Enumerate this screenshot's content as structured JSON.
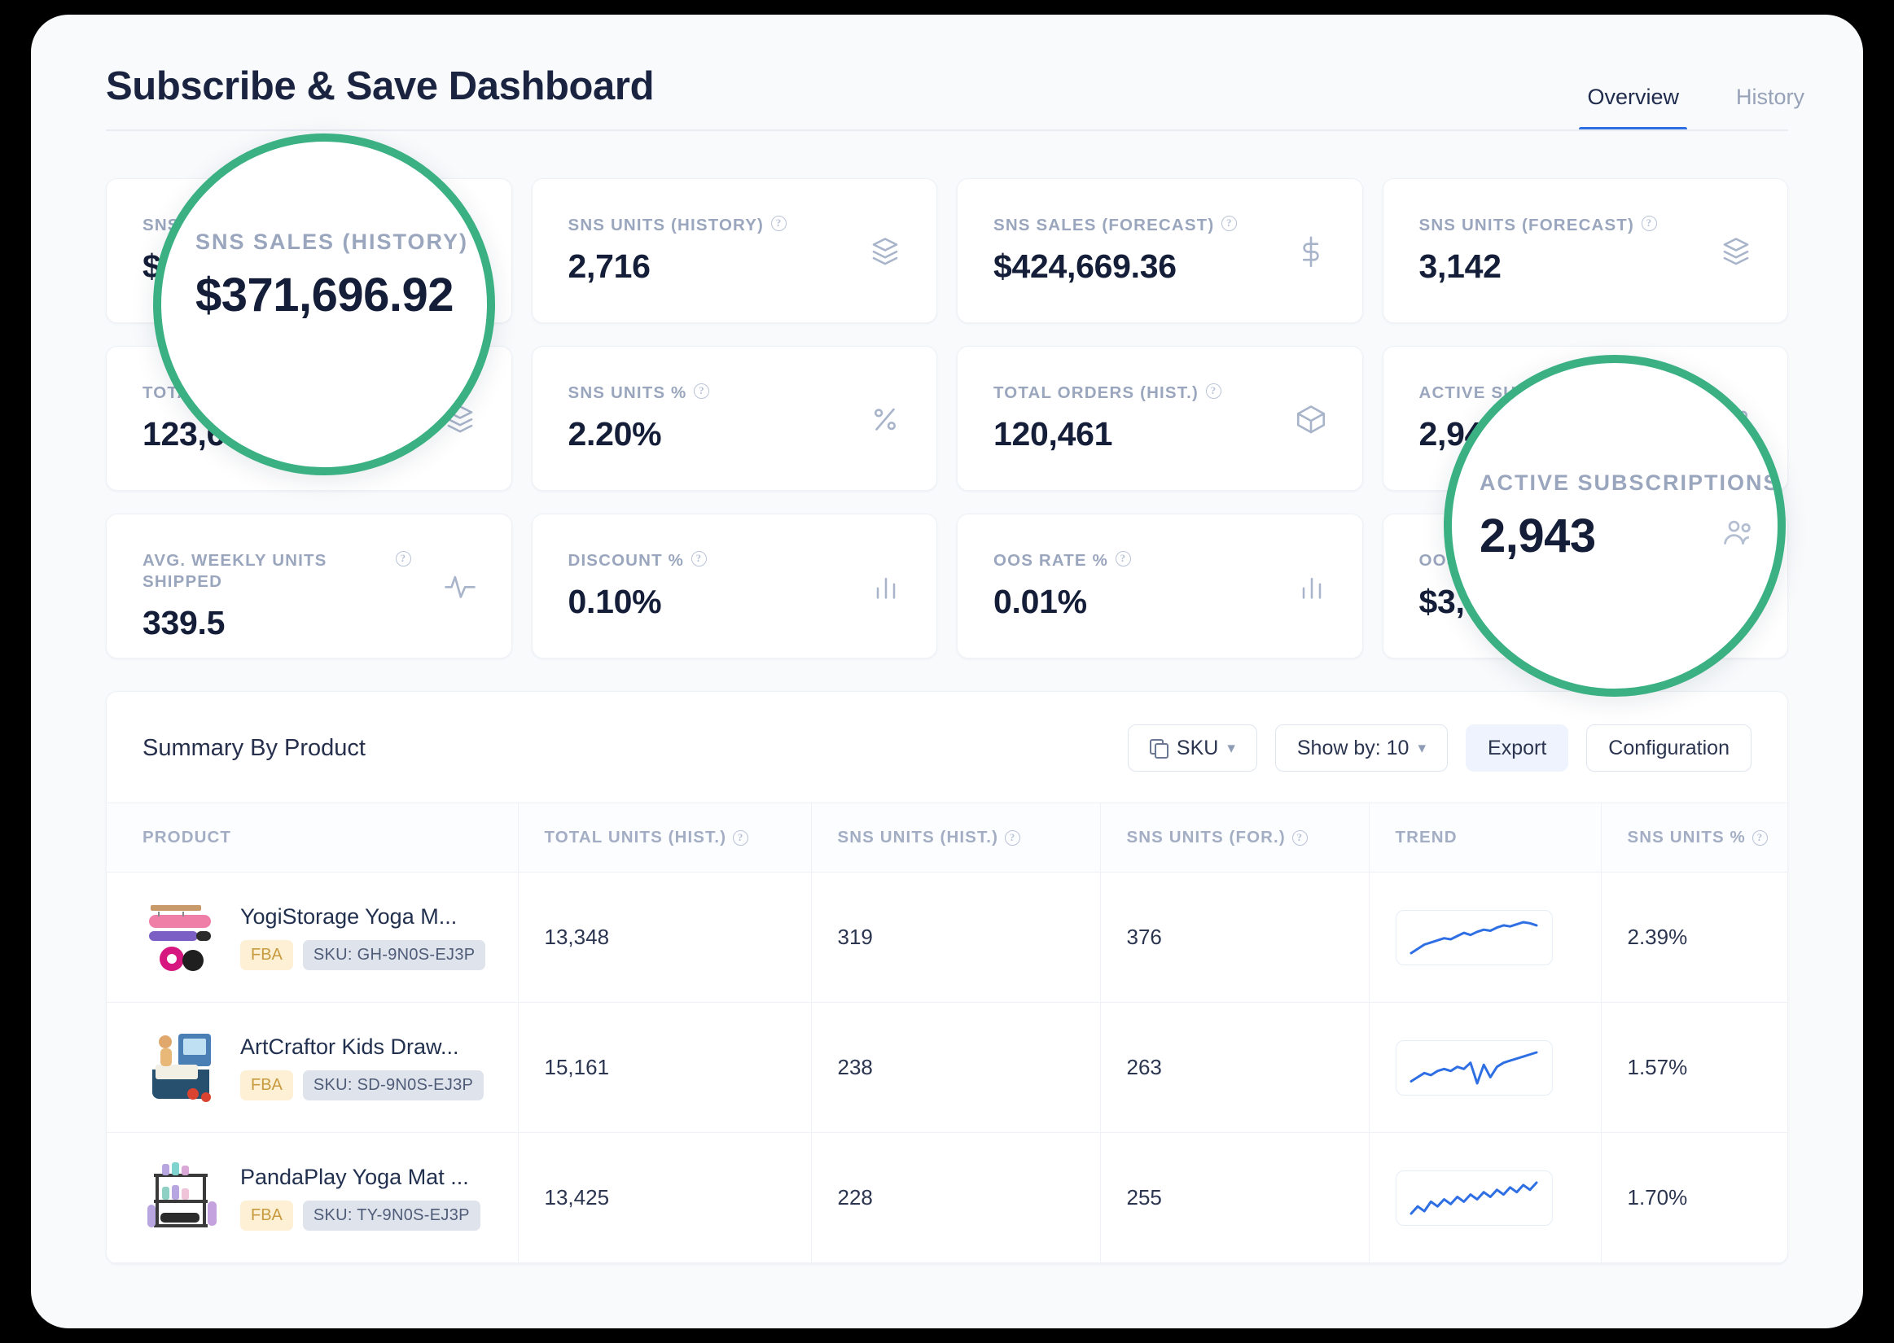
{
  "page": {
    "title": "Subscribe & Save Dashboard"
  },
  "tabs": [
    {
      "label": "Overview",
      "active": true
    },
    {
      "label": "History",
      "active": false
    }
  ],
  "kpis": [
    {
      "label": "SNS SALES (HISTORY)",
      "value": "$371,696.92",
      "icon": "dollar-icon",
      "help": true,
      "occluded": true
    },
    {
      "label": "SNS UNITS (HISTORY)",
      "value": "2,716",
      "icon": "layers-icon",
      "help": true
    },
    {
      "label": "SNS SALES (FORECAST)",
      "value": "$424,669.36",
      "icon": "dollar-icon",
      "help": true
    },
    {
      "label": "SNS UNITS (FORECAST)",
      "value": "3,142",
      "icon": "layers-icon",
      "help": true
    },
    {
      "label": "TOTAL",
      "value": "123,600",
      "icon": "layers-icon",
      "help": false,
      "occluded": true
    },
    {
      "label": "SNS UNITS %",
      "value": "2.20%",
      "icon": "percent-icon",
      "help": true
    },
    {
      "label": "TOTAL ORDERS (HIST.)",
      "value": "120,461",
      "icon": "box-icon",
      "help": true
    },
    {
      "label": "ACTIVE SUBSCRIPTIONS",
      "value": "2,943",
      "icon": "people-icon",
      "help": false,
      "occluded": true
    },
    {
      "label": "AVG. WEEKLY UNITS SHIPPED",
      "value": "339.5",
      "icon": "pulse-icon",
      "help": true
    },
    {
      "label": "DISCOUNT %",
      "value": "0.10%",
      "icon": "bars-icon",
      "help": true
    },
    {
      "label": "OOS RATE %",
      "value": "0.01%",
      "icon": "bars-icon",
      "help": true
    },
    {
      "label": "OOS",
      "value": "$3,522.83",
      "icon": "dollar-icon",
      "help": false,
      "occluded": true
    }
  ],
  "magnifiers": {
    "left": {
      "label": "SNS SALES (HISTORY)",
      "value": "$371,696.92",
      "help": true
    },
    "right": {
      "label": "ACTIVE SUBSCRIPTIONS",
      "value": "2,943",
      "help": false
    }
  },
  "summary": {
    "title": "Summary By Product",
    "tools": {
      "sku_label": "SKU",
      "show_by_label": "Show by: 10",
      "export_label": "Export",
      "configuration_label": "Configuration"
    },
    "columns": [
      {
        "label": "PRODUCT",
        "help": false
      },
      {
        "label": "TOTAL UNITS (HIST.)",
        "help": true
      },
      {
        "label": "SNS UNITS (HIST.)",
        "help": true
      },
      {
        "label": "SNS UNITS (FOR.)",
        "help": true
      },
      {
        "label": "TREND",
        "help": false
      },
      {
        "label": "SNS UNITS %",
        "help": true
      }
    ],
    "rows": [
      {
        "name": "YogiStorage Yoga M...",
        "fba": "FBA",
        "sku": "SKU: GH-9N0S-EJ3P",
        "total_units_hist": "13,348",
        "sns_units_hist": "319",
        "sns_units_for": "376",
        "sns_units_pct": "2.39%",
        "trend": [
          14,
          18,
          22,
          24,
          26,
          28,
          27,
          30,
          33,
          31,
          34,
          36,
          35,
          38,
          40,
          39,
          41,
          43,
          42,
          40
        ]
      },
      {
        "name": "ArtCraftor Kids Draw...",
        "fba": "FBA",
        "sku": "SKU: SD-9N0S-EJ3P",
        "total_units_hist": "15,161",
        "sns_units_hist": "238",
        "sns_units_for": "263",
        "sns_units_pct": "1.57%",
        "trend": [
          16,
          20,
          24,
          22,
          26,
          28,
          26,
          30,
          28,
          34,
          14,
          32,
          20,
          30,
          34,
          36,
          38,
          40,
          42,
          44
        ]
      },
      {
        "name": "PandaPlay Yoga Mat ...",
        "fba": "FBA",
        "sku": "SKU: TY-9N0S-EJ3P",
        "total_units_hist": "13,425",
        "sns_units_hist": "228",
        "sns_units_for": "255",
        "sns_units_pct": "1.70%",
        "trend": [
          18,
          24,
          20,
          28,
          24,
          30,
          26,
          32,
          28,
          34,
          30,
          36,
          32,
          38,
          34,
          40,
          36,
          42,
          38,
          44
        ]
      }
    ]
  },
  "colors": {
    "accent_blue": "#2f6fe4",
    "magnifier_green": "#3bb183",
    "badge_fba_bg": "#fdf0d5",
    "badge_sku_bg": "#dfe3ec",
    "text_dark": "#151e38",
    "text_muted": "#9aa6bd"
  }
}
